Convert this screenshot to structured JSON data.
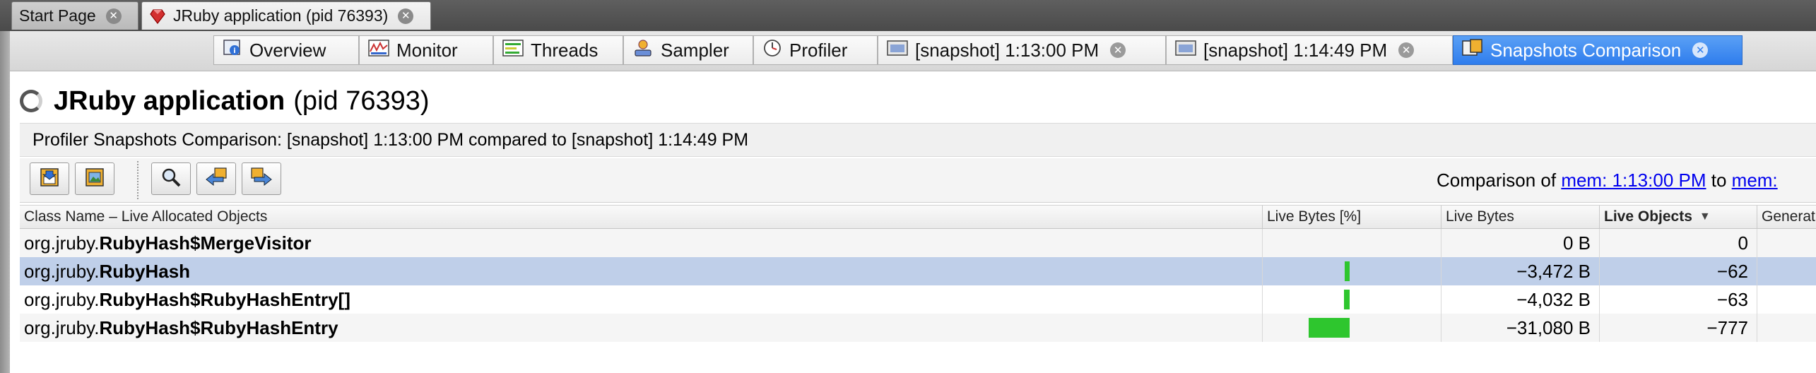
{
  "doc_tabs": [
    {
      "label": "Start Page",
      "active": false
    },
    {
      "label": "JRuby application (pid 76393)",
      "active": true
    }
  ],
  "view_tabs": [
    {
      "label": "Overview",
      "icon": "overview-icon"
    },
    {
      "label": "Monitor",
      "icon": "monitor-icon"
    },
    {
      "label": "Threads",
      "icon": "threads-icon"
    },
    {
      "label": "Sampler",
      "icon": "sampler-icon"
    },
    {
      "label": "Profiler",
      "icon": "profiler-icon"
    },
    {
      "label": "[snapshot] 1:13:00 PM",
      "icon": "snapshot-icon",
      "closable": true
    },
    {
      "label": "[snapshot] 1:14:49 PM",
      "icon": "snapshot-icon",
      "closable": true
    },
    {
      "label": "Snapshots Comparison",
      "icon": "comparison-icon",
      "closable": true,
      "active": true
    }
  ],
  "header": {
    "title": "JRuby application",
    "pid": "(pid 76393)"
  },
  "subtitle": "Profiler Snapshots Comparison: [snapshot] 1:13:00 PM compared to [snapshot] 1:14:49 PM",
  "toolbar": {
    "buttons": [
      "export-icon",
      "save-image-icon",
      "find-icon",
      "back-icon",
      "forward-icon"
    ],
    "comparison_prefix": "Comparison of ",
    "link1": "mem: 1:13:00 PM",
    "mid": " to ",
    "link2": "mem: "
  },
  "table": {
    "columns": [
      "Class Name – Live Allocated Objects",
      "Live Bytes [%]",
      "Live Bytes",
      "Live Objects",
      "Generati"
    ],
    "sorted_column": "Live Objects",
    "rows": [
      {
        "pkg": "org.jruby.",
        "cls": "RubyHash$MergeVisitor",
        "live_bytes": "0 B",
        "live_objects": "0",
        "bar_fraction": 0.0
      },
      {
        "pkg": "org.jruby.",
        "cls": "RubyHash",
        "live_bytes": "−3,472 B",
        "live_objects": "−62",
        "bar_fraction": 0.11,
        "selected": true
      },
      {
        "pkg": "org.jruby.",
        "cls": "RubyHash$RubyHashEntry[]",
        "live_bytes": "−4,032 B",
        "live_objects": "−63",
        "bar_fraction": 0.13
      },
      {
        "pkg": "org.jruby.",
        "cls": "RubyHash$RubyHashEntry",
        "live_bytes": "−31,080 B",
        "live_objects": "−777",
        "bar_fraction": 1.0
      }
    ]
  },
  "colors": {
    "selection": "#bfcfe9",
    "bar": "#2ec62e",
    "active_tab": "#2f7ded",
    "link": "#0000ee"
  }
}
